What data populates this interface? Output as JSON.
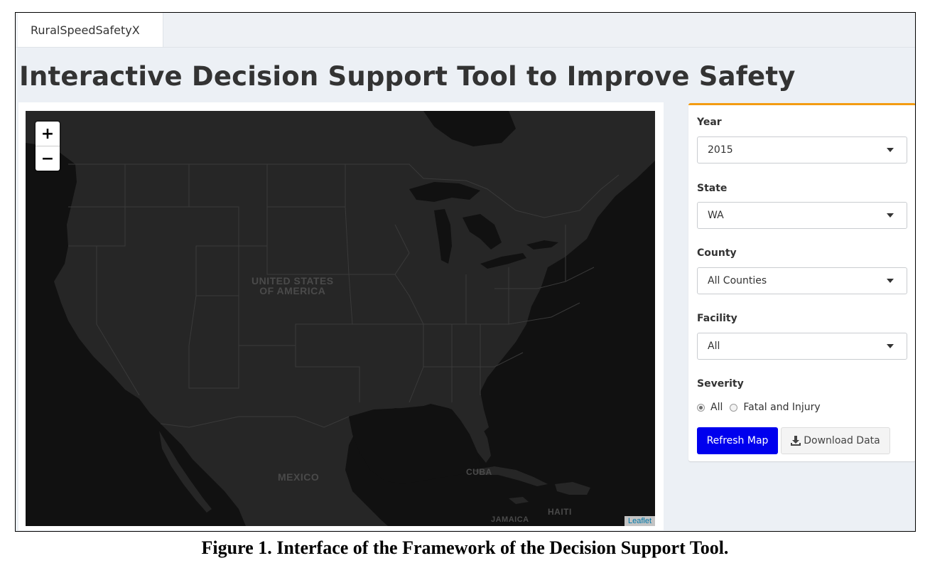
{
  "app": {
    "tab_label": "RuralSpeedSafetyX"
  },
  "page": {
    "title": "Interactive Decision Support Tool to Improve Safety"
  },
  "map": {
    "zoom_in_label": "+",
    "zoom_out_label": "−",
    "labels": {
      "usa_line1": "UNITED STATES",
      "usa_line2": "OF AMERICA",
      "mexico": "MEXICO",
      "cuba": "CUBA",
      "haiti": "HAITI",
      "jamaica": "JAMAICA"
    },
    "attribution": "Leaflet",
    "colors": {
      "land": "#262626",
      "water": "#111111",
      "border": "#3d3d3d"
    }
  },
  "panel": {
    "accent_color": "#f39c12",
    "year": {
      "label": "Year",
      "value": "2015"
    },
    "state": {
      "label": "State",
      "value": "WA"
    },
    "county": {
      "label": "County",
      "value": "All Counties"
    },
    "facility": {
      "label": "Facility",
      "value": "All"
    },
    "severity": {
      "label": "Severity",
      "options": [
        {
          "label": "All",
          "selected": true
        },
        {
          "label": "Fatal and Injury",
          "selected": false
        }
      ]
    },
    "refresh_label": "Refresh Map",
    "download_label": "Download Data",
    "refresh_color": "#0000ee"
  },
  "caption": "Figure 1. Interface of the Framework of the Decision Support Tool."
}
